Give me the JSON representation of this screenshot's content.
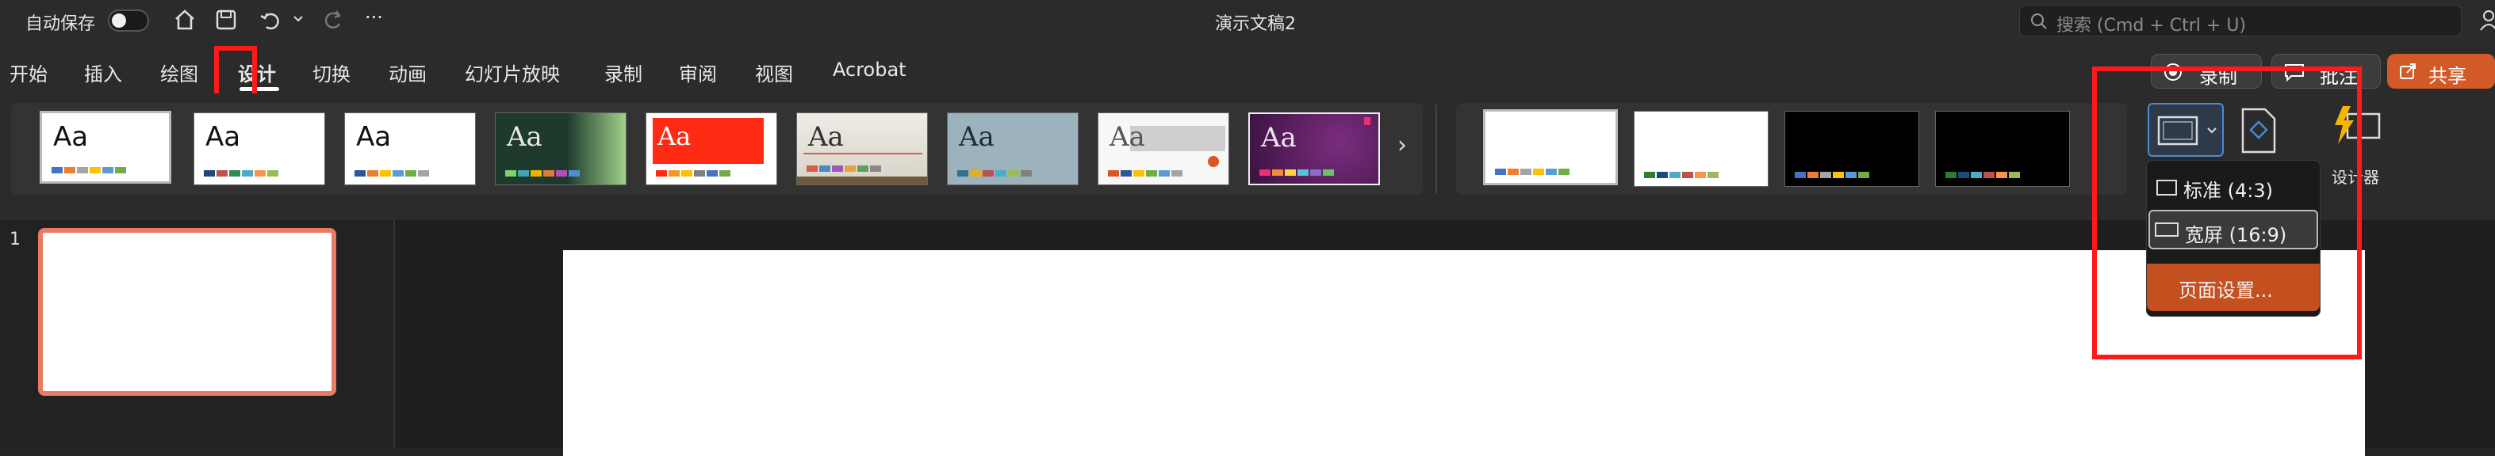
{
  "titlebar": {
    "autosave_label": "自动保存",
    "document_title": "演示文稿2",
    "search_placeholder": "搜索 (Cmd + Ctrl + U)",
    "more": "···"
  },
  "tabs": [
    "开始",
    "插入",
    "绘图",
    "设计",
    "切换",
    "动画",
    "幻灯片放映",
    "录制",
    "审阅",
    "视图",
    "Acrobat"
  ],
  "active_tab": "设计",
  "header_buttons": {
    "record": "录制",
    "comment": "批注",
    "share": "共享"
  },
  "themes_more": "›",
  "designer_label": "设计器",
  "slide_size_menu": {
    "options": [
      "标准 (4:3)",
      "宽屏 (16:9)"
    ],
    "selected": "宽屏 (16:9)",
    "page_setup": "页面设置..."
  },
  "slide_number": "1",
  "colors": {
    "accent_orange": "#c4501f",
    "share_orange": "#d35a26",
    "highlight_red": "#ff1a1a",
    "thumb_border": "#ea7a62"
  }
}
